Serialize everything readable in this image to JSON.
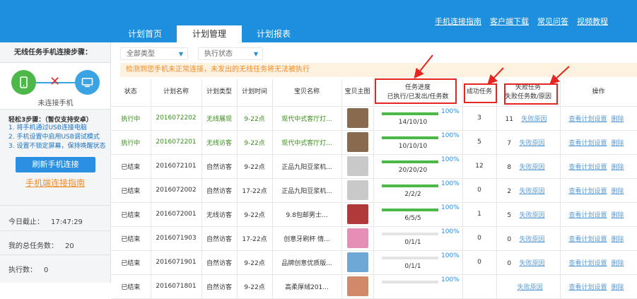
{
  "header": {
    "links": [
      "手机连接指南",
      "客户端下载",
      "常见问答",
      "视频教程"
    ],
    "tabs": [
      {
        "label": "计划首页",
        "active": false
      },
      {
        "label": "计划管理",
        "active": true
      },
      {
        "label": "计划报表",
        "active": false
      }
    ]
  },
  "sidebar": {
    "title": "无线任务手机连接步骤：",
    "connection_status": "未连接手机",
    "steps_title": "轻松3步骤：（暂仅支持安卓）",
    "steps": [
      "1. 将手机通过USB连接电脑",
      "2. 手机设置中启用USB调试模式",
      "3. 设置不锁定屏幕，保持唤醒状态"
    ],
    "refresh_label": "刷新手机连接",
    "guide_label": "手机端连接指南",
    "stats": [
      {
        "label": "今日截止：",
        "value": "17:47:29"
      },
      {
        "label": "我的总任务数：",
        "value": "20"
      },
      {
        "label": "执行数：",
        "value": "0"
      }
    ]
  },
  "filters": {
    "type": "全部类型",
    "status": "执行状态"
  },
  "warning": "检测到您手机未正常连接，未发出的无线任务将无法被执行",
  "table": {
    "headers": {
      "status": "状态",
      "plan_name": "计划名称",
      "plan_type": "计划类型",
      "plan_time": "计划时间",
      "item_name": "宝贝名称",
      "main_image": "宝贝主图",
      "progress_1": "任务进度",
      "progress_2": "已执行/已发出/任务数",
      "success": "成功任务",
      "failed_1": "失败任务",
      "failed_2": "失败任务数/原因",
      "action": "操作"
    },
    "reason_label": "失败原因",
    "view_label": "查看计划设置",
    "delete_label": "删除",
    "rows": [
      {
        "status": "执行中",
        "id": "2016072202",
        "type": "无线展现",
        "time": "9-22点",
        "name": "现代中式客厅灯...",
        "percent": "100%",
        "fill": 1.0,
        "progress": "14/10/10",
        "success": "3",
        "failed": "11",
        "thumb": "#8a6a4e",
        "running": true
      },
      {
        "status": "执行中",
        "id": "2016072201",
        "type": "无线访客",
        "time": "9-22点",
        "name": "现代中式客厅灯...",
        "percent": "100%",
        "fill": 1.0,
        "progress": "10/10/10",
        "success": "5",
        "failed": "7",
        "thumb": "#8a6a4e",
        "running": true
      },
      {
        "status": "已结束",
        "id": "2016072101",
        "type": "自然访客",
        "time": "9-22点",
        "name": "正品九阳豆浆机...",
        "percent": "100%",
        "fill": 1.0,
        "progress": "20/20/20",
        "success": "12",
        "failed": "8",
        "thumb": "#c9c9c9",
        "running": false
      },
      {
        "status": "已结束",
        "id": "2016072002",
        "type": "自然访客",
        "time": "17-22点",
        "name": "正品九阳豆浆机...",
        "percent": "100%",
        "fill": 1.0,
        "progress": "2/2/2",
        "success": "0",
        "failed": "2",
        "thumb": "#c9c9c9",
        "running": false
      },
      {
        "status": "已结束",
        "id": "2016072001",
        "type": "无线访客",
        "time": "9-22点",
        "name": "9.8包邮男士...",
        "percent": "100%",
        "fill": 1.0,
        "progress": "6/5/5",
        "success": "1",
        "failed": "5",
        "thumb": "#b03a3a",
        "running": false
      },
      {
        "status": "已结束",
        "id": "2016071903",
        "type": "自然访客",
        "time": "17-22点",
        "name": "创意牙刷杯 情...",
        "percent": "100%",
        "fill": 0.0,
        "progress": "0/1/1",
        "success": "0",
        "failed": "0",
        "thumb": "#e58fb6",
        "running": false
      },
      {
        "status": "已结束",
        "id": "2016071901",
        "type": "自然访客",
        "time": "9-22点",
        "name": "品牌创意优质版...",
        "percent": "100%",
        "fill": 0.0,
        "progress": "0/1/1",
        "success": "0",
        "failed": "0",
        "thumb": "#6ea8d6",
        "running": false
      },
      {
        "status": "已结束",
        "id": "2016071801",
        "type": "自然访客",
        "time": "9-22点",
        "name": "高柔厚绒201...",
        "percent": "100%",
        "fill": 0.0,
        "progress": "",
        "success": "",
        "failed": "",
        "thumb": "#d08a6a",
        "running": false
      }
    ]
  },
  "colors": {
    "header_blue": "#1e8fdc",
    "highlight_red": "#e52520",
    "progress_green": "#4cb847",
    "link_orange": "#f08c2a"
  }
}
